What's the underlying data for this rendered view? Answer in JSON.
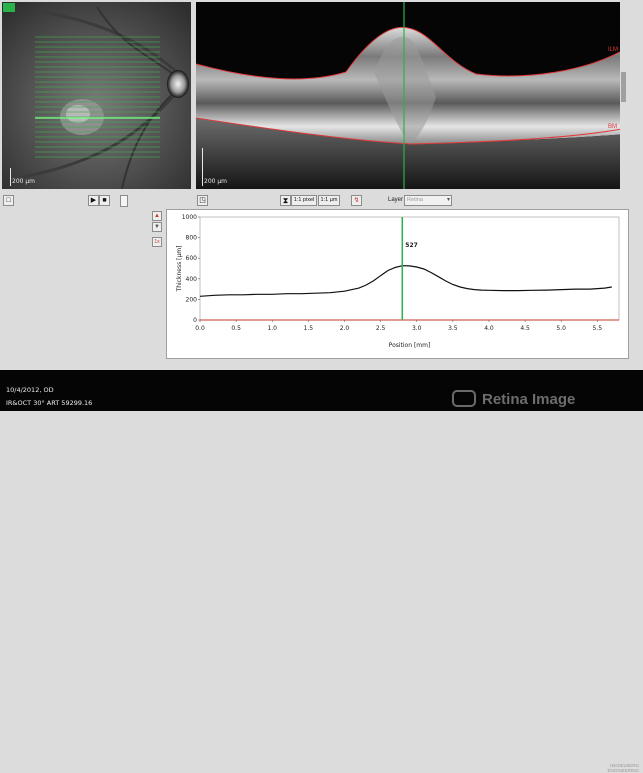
{
  "fundus": {
    "scale_label": "200 µm",
    "corner_badge": "30"
  },
  "oct": {
    "scale_label": "200 µm",
    "ilm_label": "ILM",
    "bm_label": "BM"
  },
  "toolbar": {
    "pixel_label": "1:1 pixel",
    "um_label": "1:1 µm",
    "layer_label": "Layer",
    "layer_value": "Retina"
  },
  "side_buttons": {
    "zoom_label": "1x"
  },
  "chart_data": {
    "type": "line",
    "xlabel": "Position [mm]",
    "ylabel": "Thickness [µm]",
    "xlim": [
      0.0,
      5.8
    ],
    "ylim": [
      0,
      1000
    ],
    "x_ticks": [
      "0.0",
      "0.5",
      "1.0",
      "1.5",
      "2.0",
      "2.5",
      "3.0",
      "3.5",
      "4.0",
      "4.5",
      "5.0",
      "5.5"
    ],
    "y_ticks": [
      "0",
      "200",
      "400",
      "600",
      "800",
      "1000"
    ],
    "marker_x": 2.8,
    "marker_label": "527",
    "line_color": "#111111",
    "marker_color": "#2bb24a",
    "axis_line_color": "#c0392b",
    "series": [
      {
        "x": [
          0.0,
          0.2,
          0.4,
          0.6,
          0.8,
          1.0,
          1.2,
          1.4,
          1.6,
          1.8,
          2.0,
          2.2,
          2.3,
          2.4,
          2.5,
          2.6,
          2.7,
          2.8,
          2.9,
          3.0,
          3.1,
          3.2,
          3.3,
          3.4,
          3.5,
          3.6,
          3.7,
          3.8,
          3.9,
          4.0,
          4.2,
          4.4,
          4.6,
          4.8,
          5.0,
          5.2,
          5.4,
          5.6,
          5.7
        ],
        "y": [
          230,
          240,
          245,
          245,
          250,
          250,
          255,
          255,
          260,
          265,
          280,
          310,
          340,
          380,
          430,
          480,
          510,
          527,
          525,
          515,
          495,
          460,
          420,
          380,
          345,
          320,
          305,
          295,
          290,
          288,
          285,
          285,
          288,
          290,
          295,
          300,
          300,
          310,
          320
        ]
      }
    ]
  },
  "footer": {
    "date_eye": "10/4/2012, OD",
    "scan_info": "IR&OCT 30° ART 59299.16",
    "watermark": "Retina Image",
    "brand": "HEIDELBERG ENGINEERING"
  }
}
